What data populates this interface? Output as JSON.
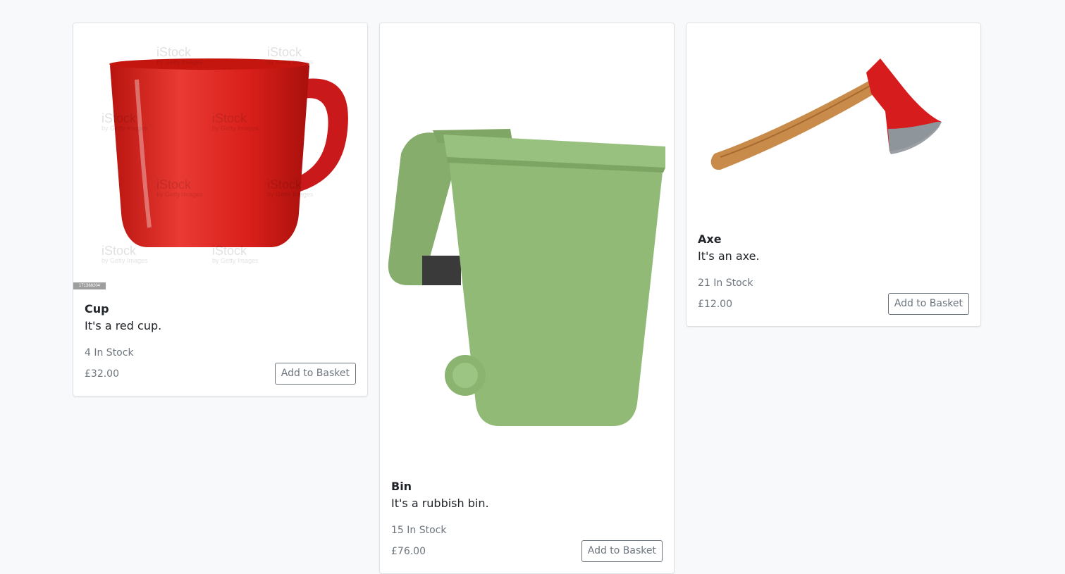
{
  "products": [
    {
      "name": "Cup",
      "description": "It's a red cup.",
      "stock": "4 In Stock",
      "price": "£32.00",
      "button": "Add to Basket",
      "image": "red-mug",
      "watermark": "iStock",
      "watermark_sub": "by Getty Images",
      "image_id": "171368204"
    },
    {
      "name": "Bin",
      "description": "It's a rubbish bin.",
      "stock": "15 In Stock",
      "price": "£76.00",
      "button": "Add to Basket",
      "image": "green-wheelie-bin"
    },
    {
      "name": "Axe",
      "description": "It's an axe.",
      "stock": "21 In Stock",
      "price": "£12.00",
      "button": "Add to Basket",
      "image": "red-axe"
    }
  ],
  "colors": {
    "background": "#f8f9fa",
    "card_border": "#dfe2e5",
    "muted_text": "#6c757d",
    "mug_red": "#d8201e",
    "bin_green": "#8fb875",
    "axe_head": "#d61c1c",
    "axe_handle": "#c98b4a"
  }
}
